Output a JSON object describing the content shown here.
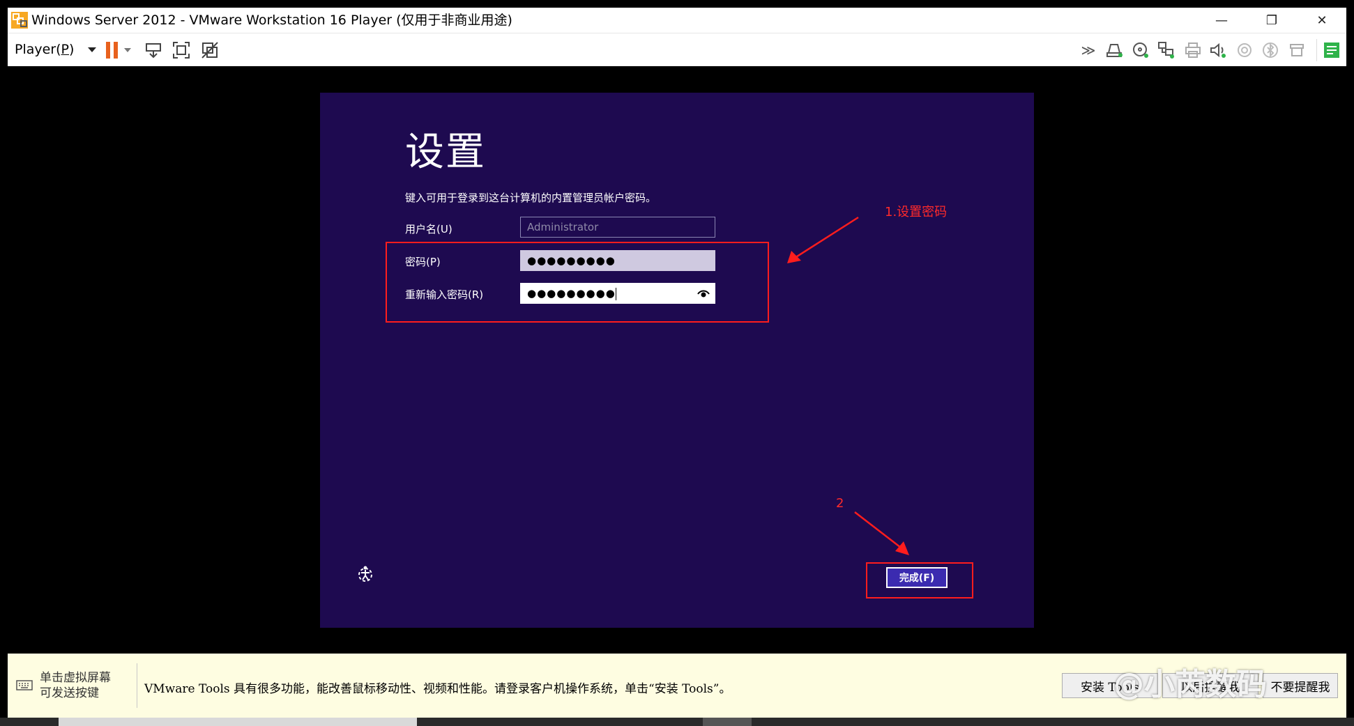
{
  "window": {
    "title": "Windows Server 2012 - VMware Workstation 16 Player (仅用于非商业用途)",
    "controls": {
      "minimize": "—",
      "restore": "❐",
      "close": "✕"
    }
  },
  "toolbar": {
    "player_menu": "Player(",
    "player_menu_hotkey": "P",
    "player_menu_close": ")",
    "icons": [
      "pause-icon",
      "send-ctrl-alt-del-icon",
      "fit-guest-icon",
      "unity-icon",
      "devices-more-icon",
      "hdd-icon",
      "cd-dvd-icon",
      "network-icon",
      "printer-icon",
      "sound-icon",
      "camera-icon",
      "bluetooth-icon",
      "usb-icon",
      "message-icon"
    ]
  },
  "guest": {
    "heading": "设置",
    "description": "键入可用于登录到这台计算机的内置管理员帐户密码。",
    "username_label": "用户名(U)",
    "username_placeholder": "Administrator",
    "password_label": "密码(P)",
    "password_value": "●●●●●●●●●",
    "reenter_label": "重新输入密码(R)",
    "reenter_value": "●●●●●●●●●",
    "finish_button": "完成(F)"
  },
  "annotations": {
    "step1": "1.设置密码",
    "step2": "2"
  },
  "notify": {
    "hint_line1": "单击虚拟屏幕",
    "hint_line2": "可发送按键",
    "message": "VMware Tools 具有很多功能，能改善鼠标移动性、视频和性能。请登录客户机操作系统，单击“安装 Tools”。",
    "install_button": "安装 Tools",
    "remind_button": "以后提醒我",
    "never_button": "不要提醒我"
  },
  "watermark": "@小芮数码",
  "colors": {
    "guest_bg": "#1e0a50",
    "annotation": "#ff1d1d",
    "notify_bg": "#fefde1",
    "pause": "#e8611d"
  }
}
